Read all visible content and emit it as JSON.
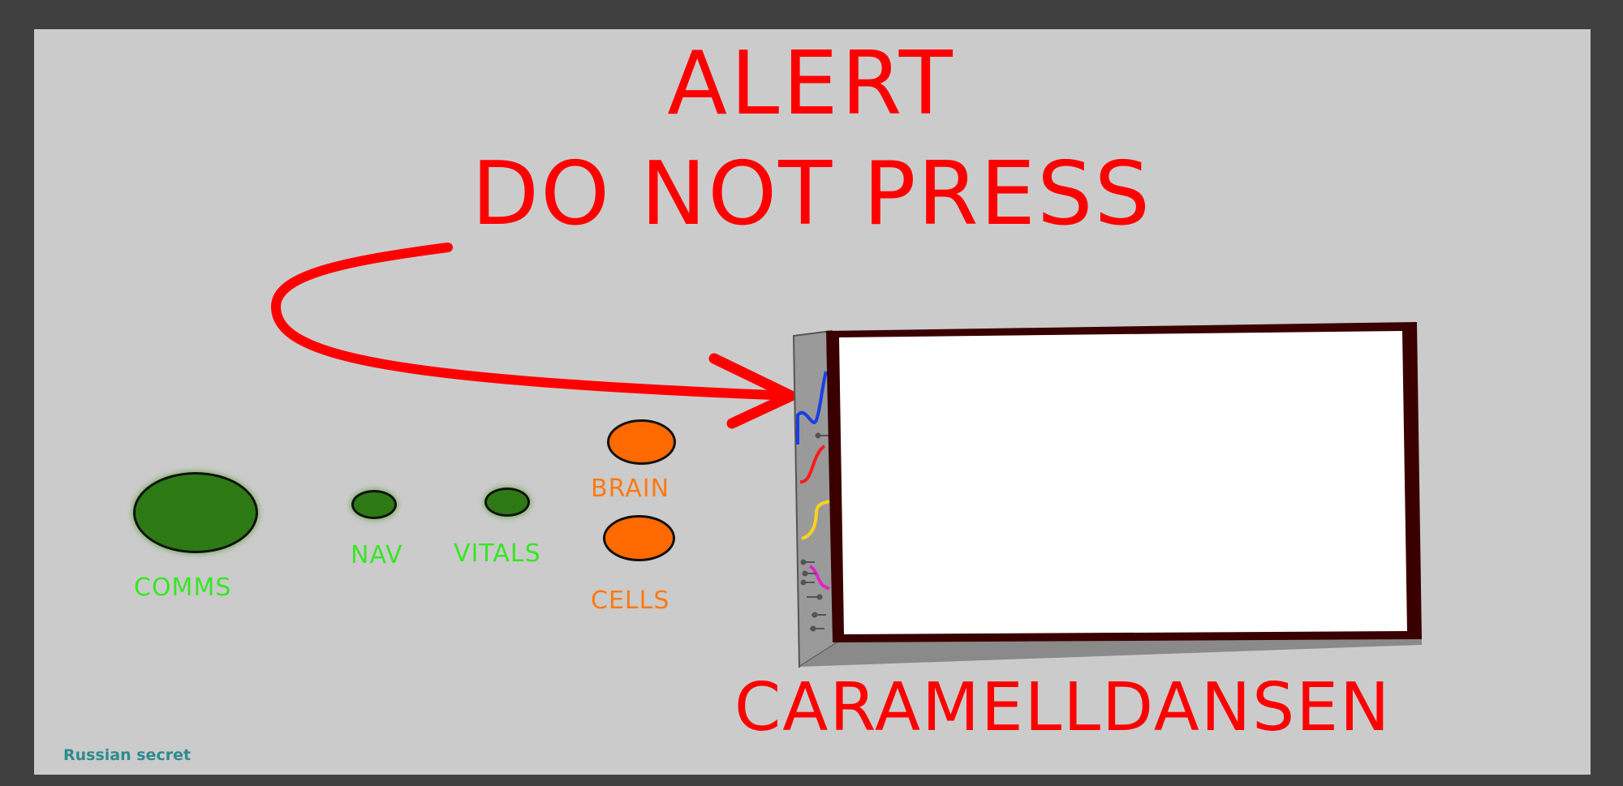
{
  "alert": {
    "line1": "ALERT",
    "line2": "DO NOT PRESS"
  },
  "screen": {
    "caption": "CARAMELLDANSEN"
  },
  "buttons": {
    "comms": {
      "label": "COMMS",
      "color": "#2d7a14"
    },
    "nav": {
      "label": "NAV",
      "color": "#2d7a14"
    },
    "vitals": {
      "label": "VITALS",
      "color": "#2d7a14"
    },
    "brain": {
      "label": "BRAIN",
      "color": "#ff6a00"
    },
    "cells": {
      "label": "CELLS",
      "color": "#ff6a00"
    }
  },
  "footer": {
    "text": "Russian secret"
  },
  "colors": {
    "background": "#404040",
    "panel": "#cbcbcb",
    "alert": "#ff0000",
    "screen_frame": "#3a0000",
    "green_label": "#39e626",
    "orange_label": "#ff7a12"
  }
}
